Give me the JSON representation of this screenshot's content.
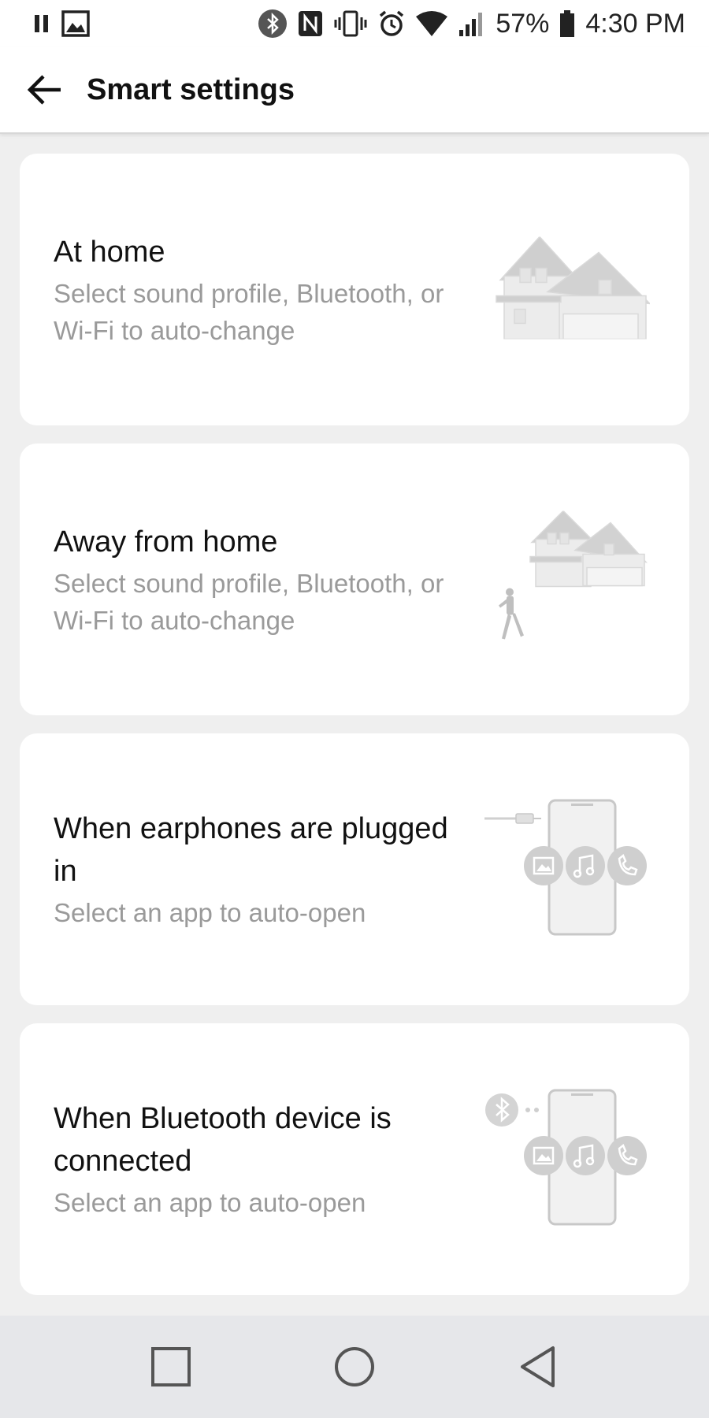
{
  "status_bar": {
    "battery_percent": "57%",
    "time": "4:30 PM",
    "icons": [
      "pause-icon",
      "image-icon",
      "bluetooth-icon",
      "nfc-icon",
      "vibrate-icon",
      "alarm-icon",
      "wifi-icon",
      "signal-icon",
      "battery-icon"
    ]
  },
  "app_bar": {
    "title": "Smart settings",
    "back_icon": "arrow-left-icon"
  },
  "cards": [
    {
      "title": "At home",
      "description": "Select sound profile, Bluetooth, or Wi-Fi to auto-change",
      "illustration": "house-icon"
    },
    {
      "title": "Away from home",
      "description": "Select sound profile, Bluetooth, or Wi-Fi to auto-change",
      "illustration": "house-walking-person-icon"
    },
    {
      "title": "When earphones are plugged in",
      "description": "Select an app to auto-open",
      "illustration": "phone-earphone-icon"
    },
    {
      "title": "When Bluetooth device is connected",
      "description": "Select an app to auto-open",
      "illustration": "phone-bluetooth-icon"
    }
  ],
  "nav_bar": {
    "recents_icon": "square-icon",
    "home_icon": "circle-icon",
    "back_icon": "triangle-back-icon"
  },
  "colors": {
    "background": "#efefef",
    "card": "#ffffff",
    "title_text": "#111111",
    "secondary_text": "#9a9a9a",
    "nav_bar": "#e6e7ea"
  }
}
